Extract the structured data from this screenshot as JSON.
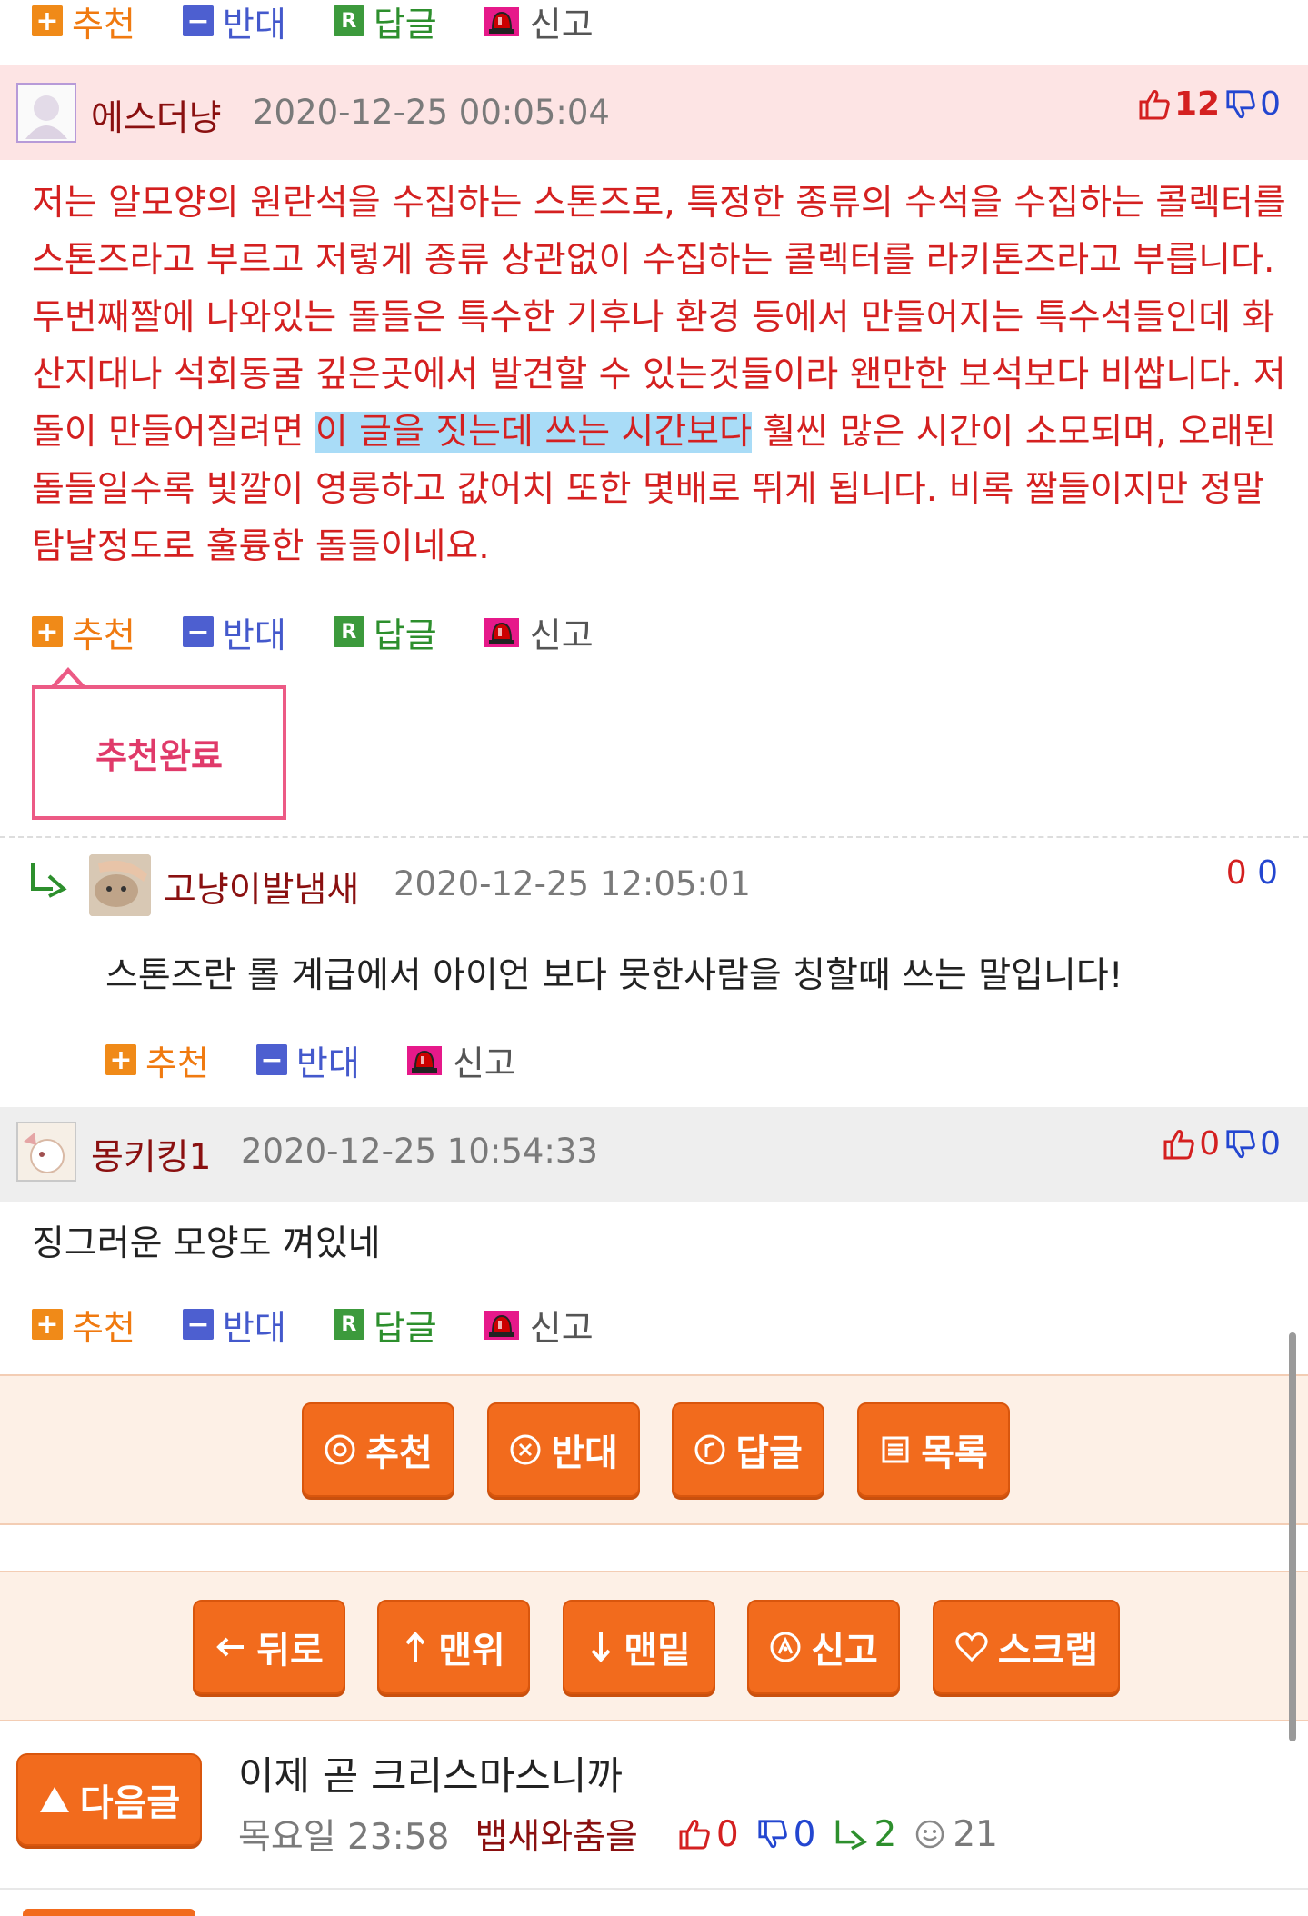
{
  "actions": {
    "recommend": "추천",
    "oppose": "반대",
    "reply": "답글",
    "report": "신고"
  },
  "comments": [
    {
      "nickname": "에스더냥",
      "date": "2020-12-25 00:05:04",
      "up": "12",
      "down": "0",
      "body_pre": "저는 알모양의 원란석을 수집하는 스톤즈로, 특정한 종류의 수석을 수집하는 콜렉터를 스톤즈라고 부르고 저렇게 종류 상관없이 수집하는 콜렉터를 라키톤즈라고 부릅니다. 두번째짤에 나와있는 돌들은 특수한 기후나 환경 등에서 만들어지는 특수석들인데 화산지대나 석회동굴 깊은곳에서 발견할 수 있는것들이라 왠만한 보석보다 비쌉니다. 저 돌이 만들어질려면 ",
      "body_highlight": "이 글을 짓는데 쓰는 시간보다",
      "body_post": " 훨씬 많은 시간이 소모되며, 오래된 돌들일수록 빛깔이 영롱하고 값어치 또한 몇배로 뛰게 됩니다. 비록 짤들이지만 정말 탐날정도로 훌륭한 돌들이네요.",
      "recommend_done": "추천완료"
    },
    {
      "nickname": "고냥이발냄새",
      "date": "2020-12-25 12:05:01",
      "score_up": "0",
      "score_down": "0",
      "body": "스톤즈란 롤 계급에서 아이언 보다 못한사람을 칭할때 쓰는 말입니다!"
    },
    {
      "nickname": "몽키킹1",
      "date": "2020-12-25 10:54:33",
      "up": "0",
      "down": "0",
      "body": "징그러운 모양도 껴있네"
    }
  ],
  "buttons_row1": [
    "추천",
    "반대",
    "답글",
    "목록"
  ],
  "buttons_row2": [
    "뒤로",
    "맨위",
    "맨밑",
    "신고",
    "스크랩"
  ],
  "next_post": {
    "button": "다음글",
    "title": "이제 곧 크리스마스니까",
    "time": "목요일 23:58",
    "author": "뱁새와춤을",
    "up": "0",
    "down": "0",
    "replies": "2",
    "views": "21"
  },
  "colors": {
    "accent_orange": "#f26b1d",
    "comment_red": "#d42020",
    "header_pink": "#fde4e4",
    "header_gray": "#eeeeee"
  }
}
